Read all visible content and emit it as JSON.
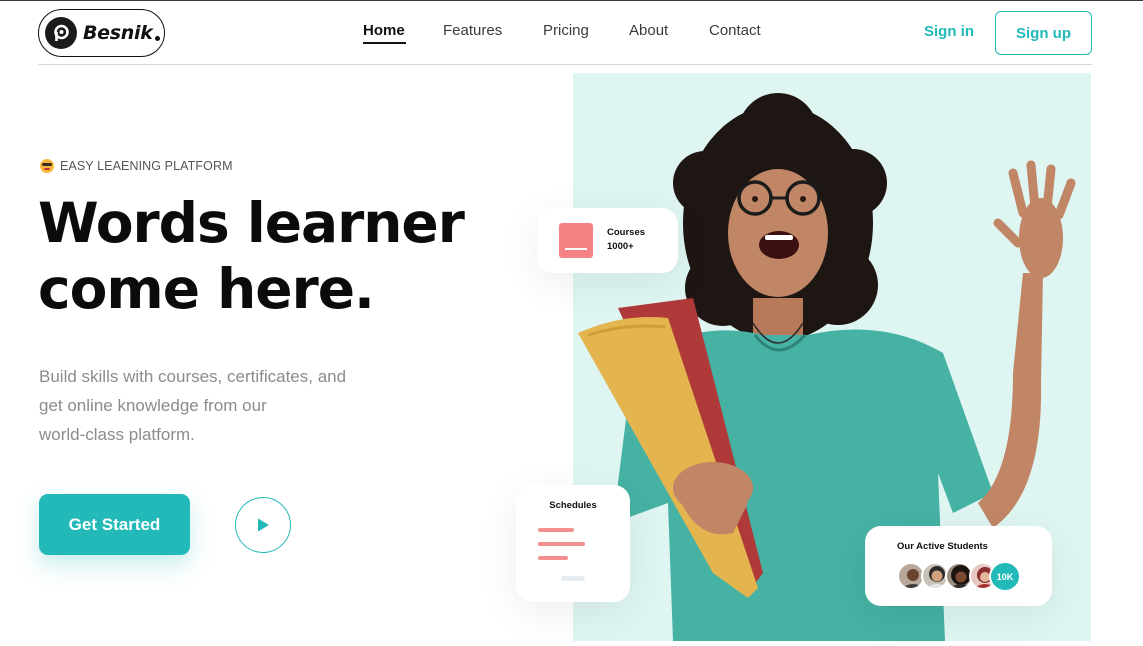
{
  "brand": {
    "name": "Besnik",
    "logo_icon": "p-circle-icon"
  },
  "nav": {
    "items": [
      {
        "label": "Home",
        "active": true
      },
      {
        "label": "Features",
        "active": false
      },
      {
        "label": "Pricing",
        "active": false
      },
      {
        "label": "About",
        "active": false
      },
      {
        "label": "Contact",
        "active": false
      }
    ]
  },
  "auth": {
    "signin_label": "Sign in",
    "signup_label": "Sign up"
  },
  "hero": {
    "eyebrow": "EASY LEAENING PLATFORM",
    "eyebrow_icon": "sunglasses-emoji-icon",
    "headline_line1": "Words learner",
    "headline_line2": "come here.",
    "subtext_line1": "Build skills with courses, certificates, and",
    "subtext_line2": "get online knowledge from our",
    "subtext_line3": "world-class platform.",
    "cta_label": "Get Started",
    "play_icon": "play-icon"
  },
  "cards": {
    "courses": {
      "title": "Courses",
      "count": "1000+"
    },
    "schedules": {
      "title": "Schedules"
    },
    "students": {
      "title": "Our Active Students",
      "count": "10K"
    }
  },
  "colors": {
    "accent": "#22b9b8",
    "coral": "#f68383",
    "hero_bg": "#def5f2",
    "text_muted": "#8c8c8c"
  }
}
